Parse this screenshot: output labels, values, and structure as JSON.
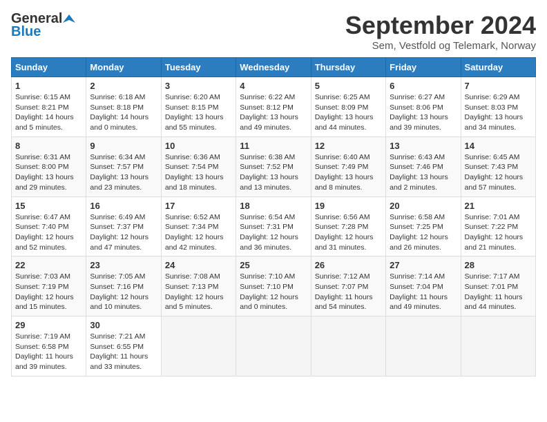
{
  "logo": {
    "general": "General",
    "blue": "Blue"
  },
  "title": "September 2024",
  "subtitle": "Sem, Vestfold og Telemark, Norway",
  "days_of_week": [
    "Sunday",
    "Monday",
    "Tuesday",
    "Wednesday",
    "Thursday",
    "Friday",
    "Saturday"
  ],
  "weeks": [
    [
      {
        "day": "1",
        "info": "Sunrise: 6:15 AM\nSunset: 8:21 PM\nDaylight: 14 hours and 5 minutes."
      },
      {
        "day": "2",
        "info": "Sunrise: 6:18 AM\nSunset: 8:18 PM\nDaylight: 14 hours and 0 minutes."
      },
      {
        "day": "3",
        "info": "Sunrise: 6:20 AM\nSunset: 8:15 PM\nDaylight: 13 hours and 55 minutes."
      },
      {
        "day": "4",
        "info": "Sunrise: 6:22 AM\nSunset: 8:12 PM\nDaylight: 13 hours and 49 minutes."
      },
      {
        "day": "5",
        "info": "Sunrise: 6:25 AM\nSunset: 8:09 PM\nDaylight: 13 hours and 44 minutes."
      },
      {
        "day": "6",
        "info": "Sunrise: 6:27 AM\nSunset: 8:06 PM\nDaylight: 13 hours and 39 minutes."
      },
      {
        "day": "7",
        "info": "Sunrise: 6:29 AM\nSunset: 8:03 PM\nDaylight: 13 hours and 34 minutes."
      }
    ],
    [
      {
        "day": "8",
        "info": "Sunrise: 6:31 AM\nSunset: 8:00 PM\nDaylight: 13 hours and 29 minutes."
      },
      {
        "day": "9",
        "info": "Sunrise: 6:34 AM\nSunset: 7:57 PM\nDaylight: 13 hours and 23 minutes."
      },
      {
        "day": "10",
        "info": "Sunrise: 6:36 AM\nSunset: 7:54 PM\nDaylight: 13 hours and 18 minutes."
      },
      {
        "day": "11",
        "info": "Sunrise: 6:38 AM\nSunset: 7:52 PM\nDaylight: 13 hours and 13 minutes."
      },
      {
        "day": "12",
        "info": "Sunrise: 6:40 AM\nSunset: 7:49 PM\nDaylight: 13 hours and 8 minutes."
      },
      {
        "day": "13",
        "info": "Sunrise: 6:43 AM\nSunset: 7:46 PM\nDaylight: 13 hours and 2 minutes."
      },
      {
        "day": "14",
        "info": "Sunrise: 6:45 AM\nSunset: 7:43 PM\nDaylight: 12 hours and 57 minutes."
      }
    ],
    [
      {
        "day": "15",
        "info": "Sunrise: 6:47 AM\nSunset: 7:40 PM\nDaylight: 12 hours and 52 minutes."
      },
      {
        "day": "16",
        "info": "Sunrise: 6:49 AM\nSunset: 7:37 PM\nDaylight: 12 hours and 47 minutes."
      },
      {
        "day": "17",
        "info": "Sunrise: 6:52 AM\nSunset: 7:34 PM\nDaylight: 12 hours and 42 minutes."
      },
      {
        "day": "18",
        "info": "Sunrise: 6:54 AM\nSunset: 7:31 PM\nDaylight: 12 hours and 36 minutes."
      },
      {
        "day": "19",
        "info": "Sunrise: 6:56 AM\nSunset: 7:28 PM\nDaylight: 12 hours and 31 minutes."
      },
      {
        "day": "20",
        "info": "Sunrise: 6:58 AM\nSunset: 7:25 PM\nDaylight: 12 hours and 26 minutes."
      },
      {
        "day": "21",
        "info": "Sunrise: 7:01 AM\nSunset: 7:22 PM\nDaylight: 12 hours and 21 minutes."
      }
    ],
    [
      {
        "day": "22",
        "info": "Sunrise: 7:03 AM\nSunset: 7:19 PM\nDaylight: 12 hours and 15 minutes."
      },
      {
        "day": "23",
        "info": "Sunrise: 7:05 AM\nSunset: 7:16 PM\nDaylight: 12 hours and 10 minutes."
      },
      {
        "day": "24",
        "info": "Sunrise: 7:08 AM\nSunset: 7:13 PM\nDaylight: 12 hours and 5 minutes."
      },
      {
        "day": "25",
        "info": "Sunrise: 7:10 AM\nSunset: 7:10 PM\nDaylight: 12 hours and 0 minutes."
      },
      {
        "day": "26",
        "info": "Sunrise: 7:12 AM\nSunset: 7:07 PM\nDaylight: 11 hours and 54 minutes."
      },
      {
        "day": "27",
        "info": "Sunrise: 7:14 AM\nSunset: 7:04 PM\nDaylight: 11 hours and 49 minutes."
      },
      {
        "day": "28",
        "info": "Sunrise: 7:17 AM\nSunset: 7:01 PM\nDaylight: 11 hours and 44 minutes."
      }
    ],
    [
      {
        "day": "29",
        "info": "Sunrise: 7:19 AM\nSunset: 6:58 PM\nDaylight: 11 hours and 39 minutes."
      },
      {
        "day": "30",
        "info": "Sunrise: 7:21 AM\nSunset: 6:55 PM\nDaylight: 11 hours and 33 minutes."
      },
      {
        "day": "",
        "info": ""
      },
      {
        "day": "",
        "info": ""
      },
      {
        "day": "",
        "info": ""
      },
      {
        "day": "",
        "info": ""
      },
      {
        "day": "",
        "info": ""
      }
    ]
  ]
}
